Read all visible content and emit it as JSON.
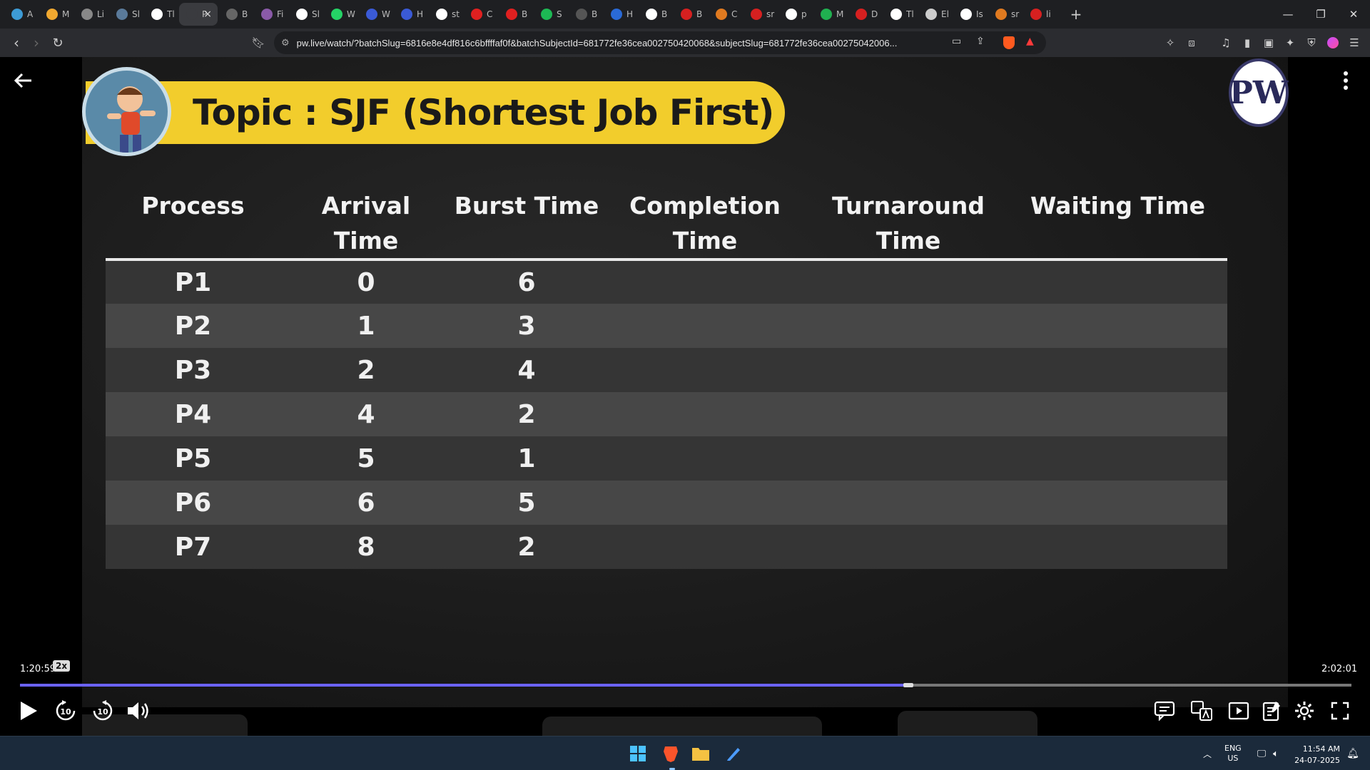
{
  "browser": {
    "tabs": [
      {
        "label": "A",
        "color": "#3d9bd6"
      },
      {
        "label": "M",
        "color": "#f0a830"
      },
      {
        "label": "Li",
        "color": "#888888"
      },
      {
        "label": "Sl",
        "color": "#5a7a9a"
      },
      {
        "label": "Tl",
        "color": "#ffffff"
      },
      {
        "label": "P",
        "color": "#3a3b3f",
        "active": true
      },
      {
        "label": "B",
        "color": "#666666"
      },
      {
        "label": "Fi",
        "color": "#8a5aa8"
      },
      {
        "label": "Sl",
        "color": "#ffffff"
      },
      {
        "label": "W",
        "color": "#25d366"
      },
      {
        "label": "W",
        "color": "#3a5ad6"
      },
      {
        "label": "H",
        "color": "#3a5ad6"
      },
      {
        "label": "st",
        "color": "#ffffff"
      },
      {
        "label": "C",
        "color": "#e02020"
      },
      {
        "label": "B",
        "color": "#e02020"
      },
      {
        "label": "S",
        "color": "#1db954"
      },
      {
        "label": "B",
        "color": "#555555"
      },
      {
        "label": "H",
        "color": "#2a6ad6"
      },
      {
        "label": "B",
        "color": "#ffffff"
      },
      {
        "label": "B",
        "color": "#d62020"
      },
      {
        "label": "C",
        "color": "#e07a20"
      },
      {
        "label": "sr",
        "color": "#d62020"
      },
      {
        "label": "p",
        "color": "#ffffff"
      },
      {
        "label": "M",
        "color": "#20b050"
      },
      {
        "label": "D",
        "color": "#d62020"
      },
      {
        "label": "Tl",
        "color": "#ffffff"
      },
      {
        "label": "El",
        "color": "#cccccc"
      },
      {
        "label": "Is",
        "color": "#ffffff"
      },
      {
        "label": "sr",
        "color": "#e07a20"
      },
      {
        "label": "li",
        "color": "#d62020"
      }
    ],
    "url": "pw.live/watch/?batchSlug=6816e8e4df816c6bffffaf0f&batchSubjectId=681772fe36cea002750420068&subjectSlug=681772fe36cea00275042006...",
    "active_tab_close": "×",
    "new_tab": "+"
  },
  "slide": {
    "topic": "Topic : SJF (Shortest Job First)",
    "logo_text": "PW",
    "table": {
      "headers": [
        [
          "Process"
        ],
        [
          "Arrival",
          "Time"
        ],
        [
          "Burst Time"
        ],
        [
          "Completion",
          "Time"
        ],
        [
          "Turnaround Time"
        ],
        [
          "Waiting Time"
        ]
      ],
      "rows": [
        [
          "P1",
          "0",
          "6",
          "",
          "",
          ""
        ],
        [
          "P2",
          "1",
          "3",
          "",
          "",
          ""
        ],
        [
          "P3",
          "2",
          "4",
          "",
          "",
          ""
        ],
        [
          "P4",
          "4",
          "2",
          "",
          "",
          ""
        ],
        [
          "P5",
          "5",
          "1",
          "",
          "",
          ""
        ],
        [
          "P6",
          "6",
          "5",
          "",
          "",
          ""
        ],
        [
          "P7",
          "8",
          "2",
          "",
          "",
          ""
        ]
      ]
    }
  },
  "player": {
    "current_time": "1:20:59",
    "speed": "2x",
    "duration": "2:02:01",
    "progress": 0.667,
    "rewind_label": "10",
    "forward_label": "10"
  },
  "taskbar": {
    "lang_line1": "ENG",
    "lang_line2": "US",
    "time": "11:54 AM",
    "date": "24-07-2025"
  }
}
